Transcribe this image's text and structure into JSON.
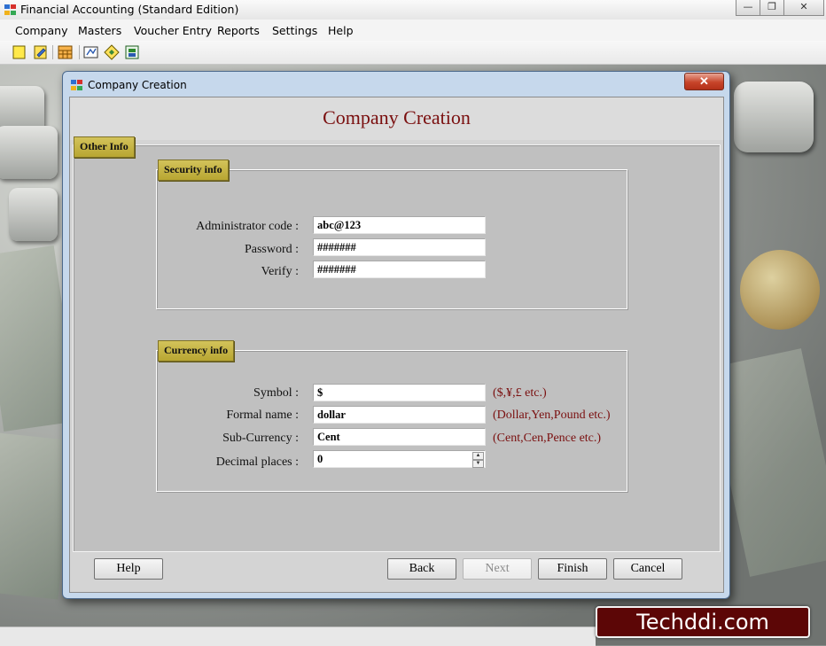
{
  "window": {
    "title": "Financial Accounting (Standard Edition)",
    "controls": {
      "minimize": "—",
      "restore": "❐",
      "close": "✕"
    }
  },
  "menu": {
    "items": [
      "Company",
      "Masters",
      "Voucher Entry",
      "Reports",
      "Settings",
      "Help"
    ]
  },
  "toolbar": {
    "icons": [
      "new-company-icon",
      "open-company-icon",
      "calculator-icon",
      "ledger-icon",
      "voucher-icon",
      "export-icon"
    ]
  },
  "dialog": {
    "title": "Company Creation",
    "close_label": "✕",
    "heading": "Company Creation",
    "tab_label": "Other Info",
    "security": {
      "label": "Security info",
      "admin_code_label": "Administrator code :",
      "admin_code_value": "abc@123",
      "password_label": "Password :",
      "password_value": "#######",
      "verify_label": "Verify :",
      "verify_value": "#######"
    },
    "currency": {
      "label": "Currency info",
      "symbol_label": "Symbol :",
      "symbol_value": "$",
      "symbol_hint": "($,¥,£ etc.)",
      "formal_name_label": "Formal name :",
      "formal_name_value": "dollar",
      "formal_name_hint": "(Dollar,Yen,Pound etc.)",
      "sub_currency_label": "Sub-Currency :",
      "sub_currency_value": "Cent",
      "sub_currency_hint": "(Cent,Cen,Pence etc.)",
      "decimal_label": "Decimal places :",
      "decimal_value": "0"
    },
    "buttons": {
      "help": "Help",
      "back": "Back",
      "next": "Next",
      "finish": "Finish",
      "cancel": "Cancel"
    }
  },
  "watermark": "Techddi.com",
  "colors": {
    "heading": "#7a0f0f",
    "tag": "#c2b040",
    "watermark_bg": "#5c0606"
  }
}
